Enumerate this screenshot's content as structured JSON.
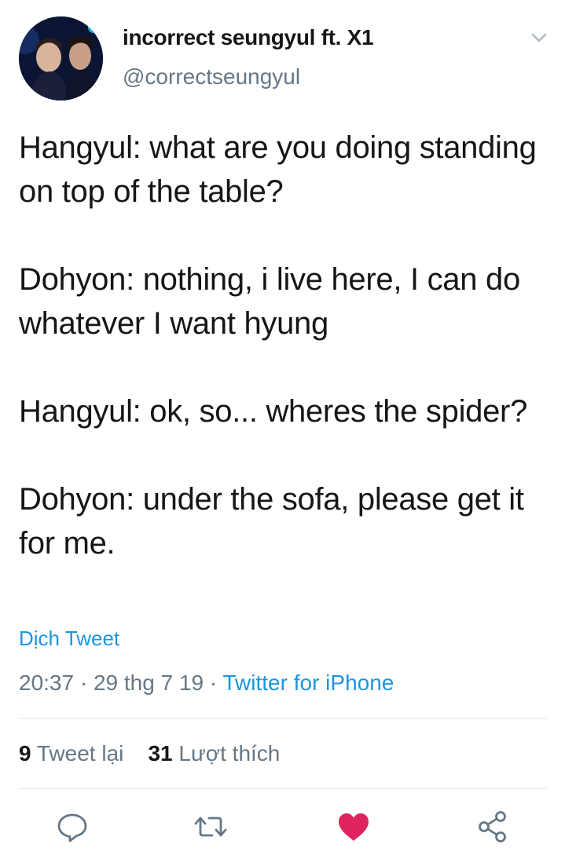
{
  "author": {
    "display_name": "incorrect seungyul ft. X1",
    "handle": "@correctseungyul"
  },
  "tweet": {
    "paragraphs": [
      "Hangyul: what are you doing standing on top of the table?",
      "Dohyon: nothing, i live here, I can do whatever I want hyung",
      "Hangyul: ok, so... wheres the spider?",
      "Dohyon: under the sofa, please get it for me."
    ],
    "translate_label": "Dịch Tweet",
    "time": "20:37",
    "date": "29 thg 7 19",
    "separator": "·",
    "source": "Twitter for iPhone"
  },
  "stats": {
    "retweets_count": "9",
    "retweets_label": "Tweet lại",
    "likes_count": "31",
    "likes_label": "Lượt thích"
  },
  "actions": {
    "reply_icon": "reply-icon",
    "retweet_icon": "retweet-icon",
    "like_icon": "heart-icon",
    "share_icon": "share-icon"
  },
  "colors": {
    "link": "#1b95e0",
    "secondary_text": "#657786",
    "like": "#e0245e",
    "divider": "#e1e8ed"
  }
}
